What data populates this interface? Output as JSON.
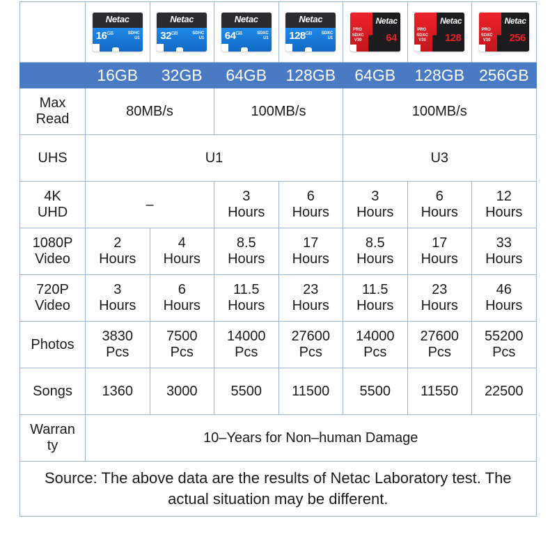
{
  "table": {
    "columns": [
      {
        "capacity": "16GB",
        "card_type": "blue",
        "card_label": "16",
        "card_brand": "Netac"
      },
      {
        "capacity": "32GB",
        "card_type": "blue",
        "card_label": "32",
        "card_brand": "Netac"
      },
      {
        "capacity": "64GB",
        "card_type": "blue",
        "card_label": "64",
        "card_brand": "Netac"
      },
      {
        "capacity": "128GB",
        "card_type": "blue",
        "card_label": "128",
        "card_brand": "Netac"
      },
      {
        "capacity": "64GB",
        "card_type": "red",
        "card_label": "64",
        "card_brand": "Netac",
        "card_badge": "PRO"
      },
      {
        "capacity": "128GB",
        "card_type": "red",
        "card_label": "128",
        "card_brand": "Netac",
        "card_badge": "PRO"
      },
      {
        "capacity": "256GB",
        "card_type": "red",
        "card_label": "256",
        "card_brand": "Netac",
        "card_badge": "PRO"
      }
    ],
    "rows": {
      "max_read": {
        "label": "Max Read",
        "label_line1": "Max",
        "label_line2": "Read",
        "values": [
          "80MB/s",
          "100MB/s",
          "100MB/s"
        ]
      },
      "uhs": {
        "label": "UHS",
        "values": [
          "U1",
          "U3"
        ]
      },
      "uhd_4k": {
        "label": "4K UHD",
        "label_line1": "4K",
        "label_line2": "UHD",
        "dash": "–",
        "values": [
          "3",
          "6",
          "3",
          "6",
          "12"
        ],
        "unit": "Hours"
      },
      "video_1080p": {
        "label": "1080P Video",
        "label_line1": "1080P",
        "label_line2": "Video",
        "values": [
          "2",
          "4",
          "8.5",
          "17",
          "8.5",
          "17",
          "33"
        ],
        "unit": "Hours"
      },
      "video_720p": {
        "label": "720P Video",
        "label_line1": "720P",
        "label_line2": "Video",
        "values": [
          "3",
          "6",
          "11.5",
          "23",
          "11.5",
          "23",
          "46"
        ],
        "unit": "Hours"
      },
      "photos": {
        "label": "Photos",
        "values": [
          "3830",
          "7500",
          "14000",
          "27600",
          "14000",
          "27600",
          "55200"
        ],
        "unit": "Pcs"
      },
      "songs": {
        "label": "Songs",
        "values": [
          "1360",
          "3000",
          "5500",
          "11500",
          "5500",
          "11550",
          "22500"
        ]
      },
      "warranty": {
        "label": "Warranty",
        "label_line1": "Warran",
        "label_line2": "ty",
        "value": "10–Years for Non–human Damage"
      }
    },
    "source_note": "Source: The above data are the results of Netac Laboratory test. The actual situation may be different."
  },
  "colors": {
    "header_band": "#4a7ac4",
    "grid_border": "#9ab3d6",
    "card_blue": "#1d7fe0",
    "card_red": "#e01c24",
    "card_dark": "#2b2b30",
    "text": "#1a1a1a"
  }
}
